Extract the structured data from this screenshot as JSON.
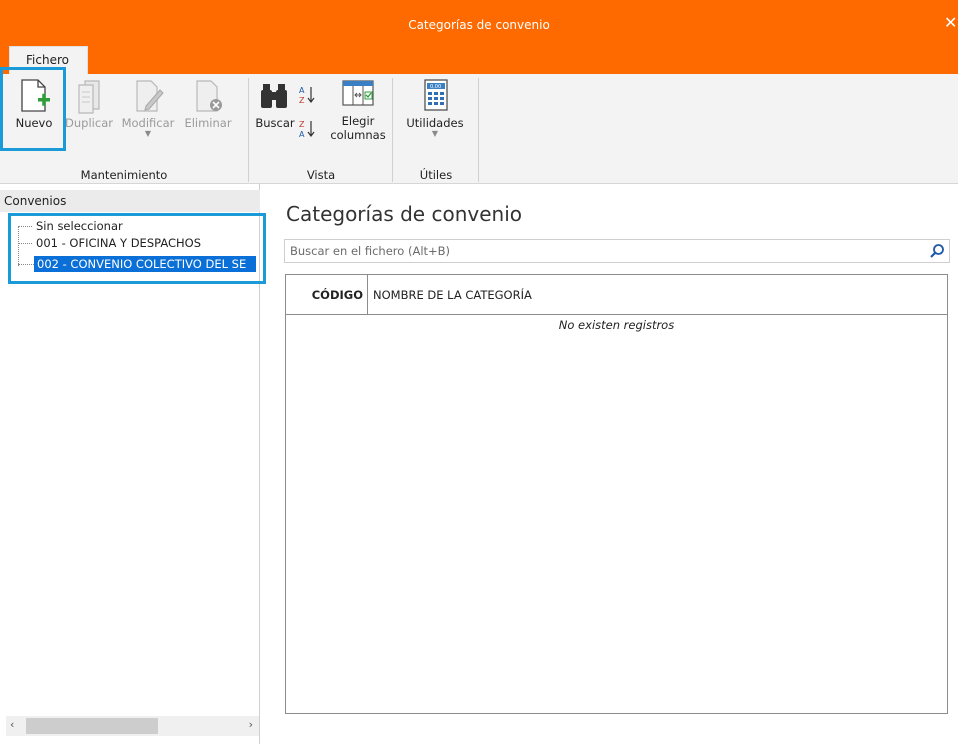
{
  "window": {
    "title": "Categorías de convenio",
    "close_glyph": "✕"
  },
  "ribbon": {
    "tab": "Fichero",
    "groups": {
      "mantenimiento": "Mantenimiento",
      "vista": "Vista",
      "utiles": "Útiles"
    },
    "buttons": {
      "nuevo": "Nuevo",
      "duplicar": "Duplicar",
      "modificar": "Modificar",
      "eliminar": "Eliminar",
      "buscar": "Buscar",
      "elegir_columnas_1": "Elegir",
      "elegir_columnas_2": "columnas",
      "utilidades": "Utilidades"
    }
  },
  "sidebar": {
    "header": "Convenios",
    "items": [
      {
        "label": "Sin seleccionar",
        "selected": false
      },
      {
        "label": "001 - OFICINA Y DESPACHOS",
        "selected": false
      },
      {
        "label": "002 - CONVENIO COLECTIVO DEL SE",
        "selected": true
      }
    ]
  },
  "main": {
    "title": "Categorías de convenio",
    "search_placeholder": "Buscar en el fichero (Alt+B)",
    "columns": [
      "CÓDIGO",
      "NOMBRE DE LA CATEGORÍA"
    ],
    "empty_message": "No existen registros"
  },
  "colors": {
    "accent": "#ff6a00",
    "highlight": "#1a9bd7",
    "selection": "#0a6fd6"
  }
}
